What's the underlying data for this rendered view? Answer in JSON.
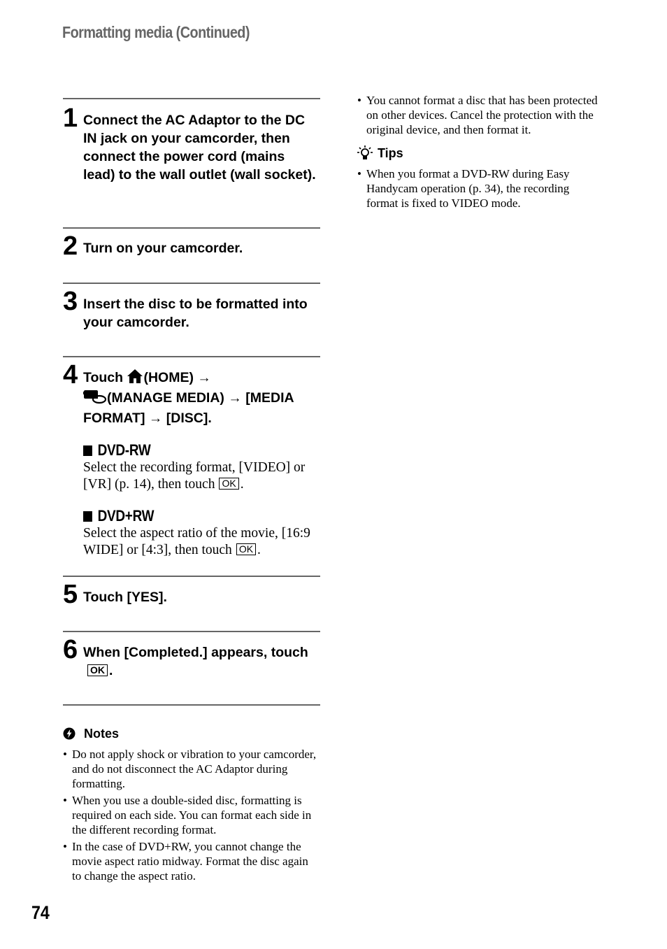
{
  "header": {
    "title": "Formatting media (Continued)"
  },
  "steps": [
    {
      "number": "1",
      "text": "Connect the AC Adaptor to the DC IN jack on your camcorder, then connect the power cord (mains lead) to the wall outlet (wall socket)."
    },
    {
      "number": "2",
      "text": "Turn on your camcorder."
    },
    {
      "number": "3",
      "text": "Insert the disc to be formatted into your camcorder."
    },
    {
      "number": "4",
      "parts": {
        "touch": "Touch",
        "home": "(HOME)",
        "arrow": "→",
        "manage": "(MANAGE MEDIA)",
        "media_format": "[MEDIA FORMAT]",
        "disc": "[DISC]."
      },
      "icons": {
        "home": "home-icon",
        "manage": "manage-media-icon"
      },
      "subsections": [
        {
          "title": "DVD-RW",
          "body": "Select the recording format, [VIDEO] or [VR] (p. 14), then touch",
          "button": "OK",
          "end": "."
        },
        {
          "title": "DVD+RW",
          "body": "Select the aspect ratio of the movie, [16:9 WIDE] or [4:3], then touch",
          "button": "OK",
          "end": "."
        }
      ]
    },
    {
      "number": "5",
      "text": "Touch [YES]."
    },
    {
      "number": "6",
      "text": "When [Completed.] appears, touch",
      "button": "OK",
      "end": "."
    }
  ],
  "notes": {
    "title": "Notes",
    "icon": "notes-icon",
    "items": [
      "Do not apply shock or vibration to your camcorder, and do not disconnect the AC Adaptor during formatting.",
      "When you use a double-sided disc, formatting is required on each side. You can format each side in the different recording format.",
      "In the case of DVD+RW, you cannot change the movie aspect ratio midway. Format the disc again to change the aspect ratio.",
      "You cannot format a disc that has been protected on other devices. Cancel the protection with the original device, and then format it."
    ]
  },
  "tips": {
    "title": "Tips",
    "icon": "lightbulb-icon",
    "items": [
      "When you format a DVD-RW during Easy Handycam operation (p. 34), the recording format is fixed to VIDEO mode."
    ]
  },
  "footer": {
    "page_number": "74"
  }
}
